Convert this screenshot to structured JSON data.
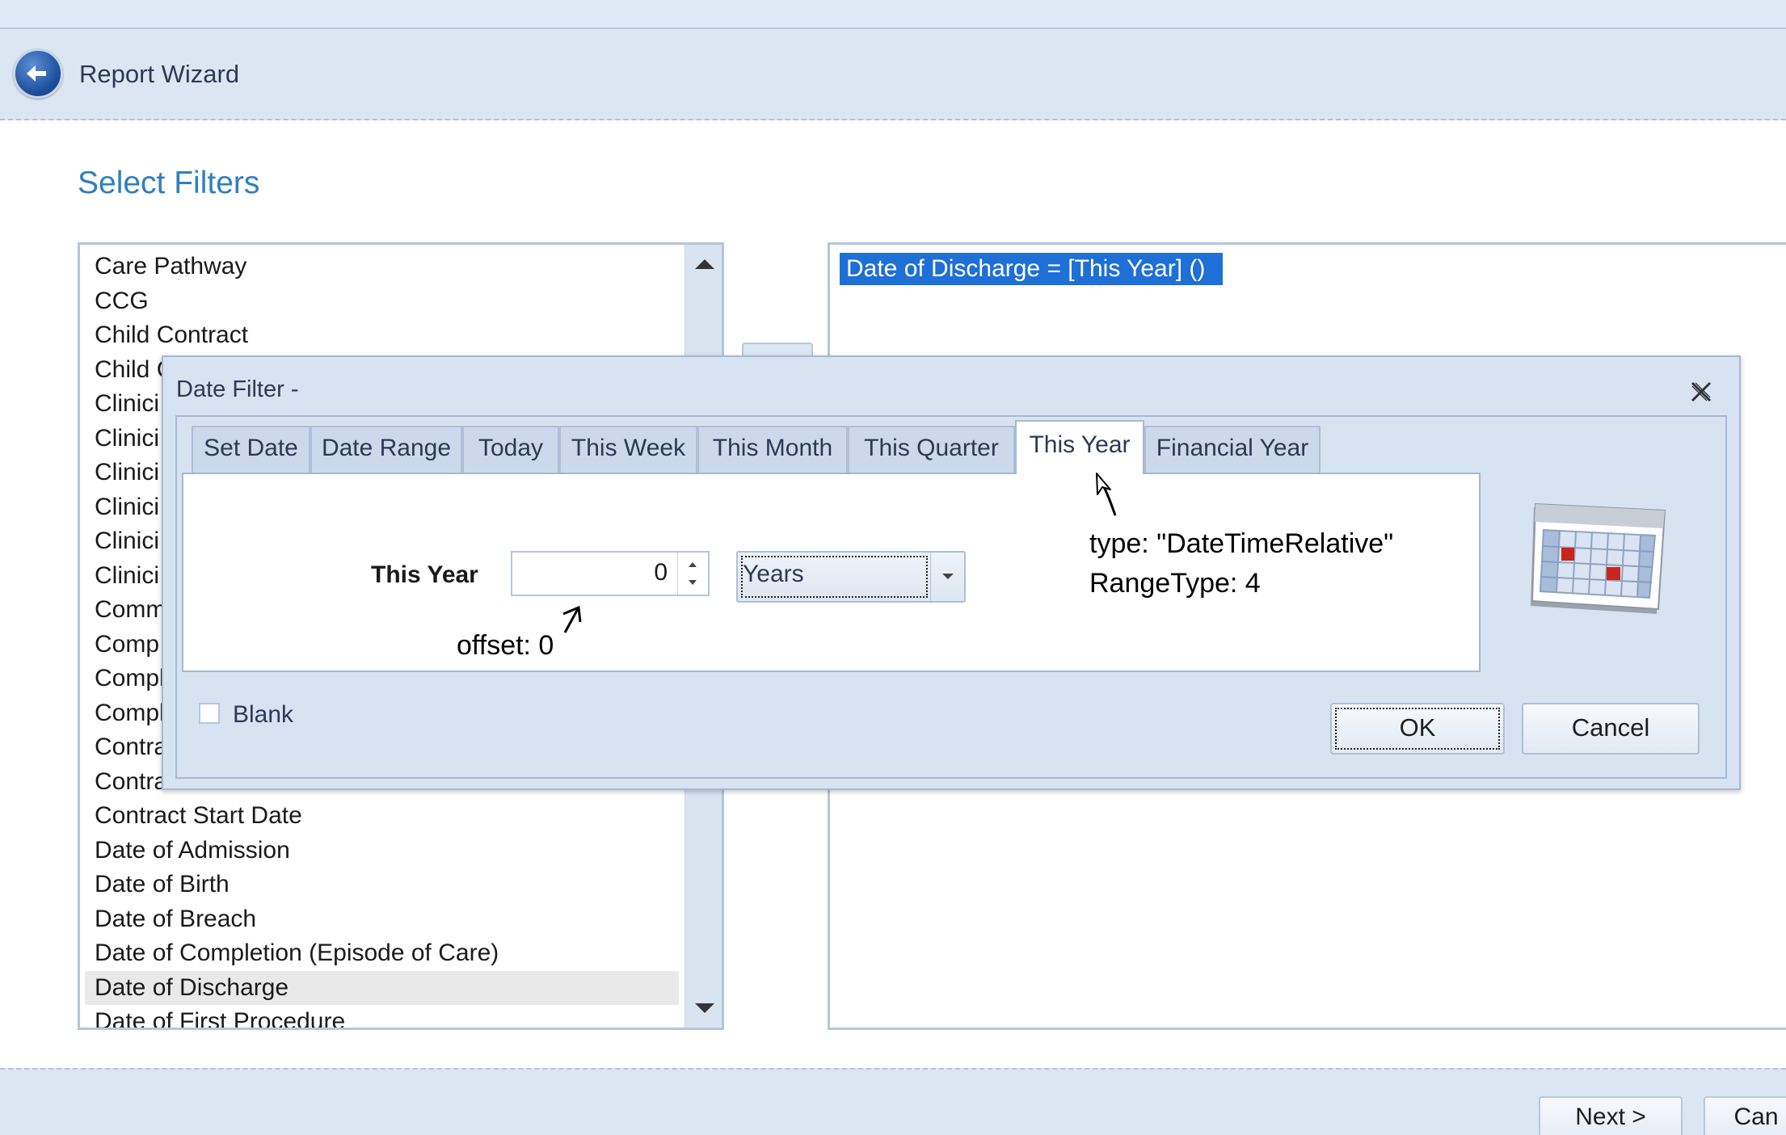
{
  "header": {
    "title": "Report Wizard"
  },
  "section_title": "Select Filters",
  "field_list": {
    "items": [
      "Care Pathway",
      "CCG",
      "Child Contract",
      "Child C",
      "Clinici",
      "Clinici",
      "Clinici",
      "Clinici",
      "Clinici",
      "Clinici",
      "Comm",
      "Comp",
      "Compl",
      "Compl",
      "Contra",
      "Contra",
      "Contract Start Date",
      "Date of Admission",
      "Date of Birth",
      "Date of Breach",
      "Date of Completion (Episode of Care)",
      "Date of Discharge",
      "Date of First Procedure"
    ],
    "selected": "Date of Discharge"
  },
  "filter_expression": "Date of Discharge = [This Year] ()",
  "dialog": {
    "title": "Date Filter -",
    "tabs": [
      "Set Date",
      "Date Range",
      "Today",
      "This Week",
      "This Month",
      "This Quarter",
      "This Year",
      "Financial Year"
    ],
    "active_tab": "This Year",
    "period_label": "This Year",
    "offset_value": "0",
    "unit_value": "Years",
    "blank_label": "Blank",
    "ok_label": "OK",
    "cancel_label": "Cancel"
  },
  "annotations": {
    "offset": "offset: 0",
    "type": "type: \"DateTimeRelative\"",
    "range_type": "RangeType: 4"
  },
  "footer": {
    "next_label": "Next >",
    "cancel_label": "Can"
  },
  "colors": {
    "accent": "#2f7fc0",
    "selection": "#1e6fd6",
    "chrome": "#dce6f3"
  },
  "icons": [
    "back-arrow-icon",
    "scroll-up-icon",
    "scroll-down-icon",
    "close-icon",
    "spin-up-icon",
    "spin-down-icon",
    "dropdown-arrow-icon",
    "calendar-icon"
  ]
}
